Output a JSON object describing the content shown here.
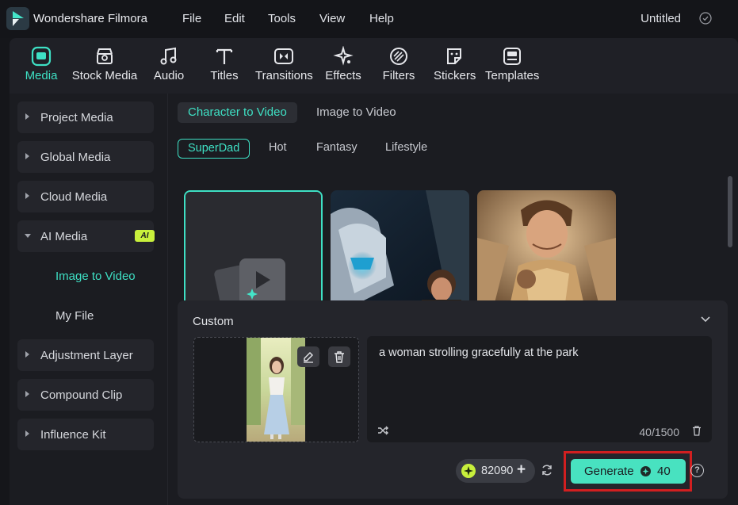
{
  "app": {
    "name": "Wondershare Filmora",
    "document_title": "Untitled",
    "menu": [
      "File",
      "Edit",
      "Tools",
      "View",
      "Help"
    ],
    "accent_color": "#3ee0c4"
  },
  "toolbar": {
    "items": [
      {
        "label": "Media",
        "icon": "media-icon",
        "active": true
      },
      {
        "label": "Stock Media",
        "icon": "stock-media-icon"
      },
      {
        "label": "Audio",
        "icon": "music-note-icon"
      },
      {
        "label": "Titles",
        "icon": "text-t-icon"
      },
      {
        "label": "Transitions",
        "icon": "transitions-icon"
      },
      {
        "label": "Effects",
        "icon": "sparkle-effects-icon"
      },
      {
        "label": "Filters",
        "icon": "filters-icon"
      },
      {
        "label": "Stickers",
        "icon": "sticker-icon"
      },
      {
        "label": "Templates",
        "icon": "templates-icon"
      }
    ]
  },
  "sidebar": {
    "items": [
      {
        "label": "Project Media"
      },
      {
        "label": "Global Media"
      },
      {
        "label": "Cloud Media"
      },
      {
        "label": "AI Media",
        "badge": "AI",
        "expanded": true
      },
      {
        "label": "Adjustment Layer"
      },
      {
        "label": "Compound Clip"
      },
      {
        "label": "Influence Kit"
      }
    ],
    "sub_items": [
      {
        "label": "Image to Video",
        "active": true
      },
      {
        "label": "My File"
      }
    ]
  },
  "content": {
    "mode_tabs": [
      {
        "label": "Character to Video",
        "active": true
      },
      {
        "label": "Image to Video"
      }
    ],
    "categories": [
      {
        "label": "SuperDad",
        "active": true
      },
      {
        "label": "Hot"
      },
      {
        "label": "Fantasy"
      },
      {
        "label": "Lifestyle"
      }
    ],
    "templates": [
      {
        "name": "custom-template",
        "icon": "image-to-video-icon"
      },
      {
        "name": "robot-astronaut-template"
      },
      {
        "name": "golden-armor-hero-template"
      }
    ]
  },
  "custom_panel": {
    "title": "Custom",
    "prompt": "a woman strolling gracefully at the park",
    "char_count": "40/1500",
    "credits": "82090",
    "generate_label": "Generate",
    "generate_cost": "40",
    "help_label": "?"
  }
}
